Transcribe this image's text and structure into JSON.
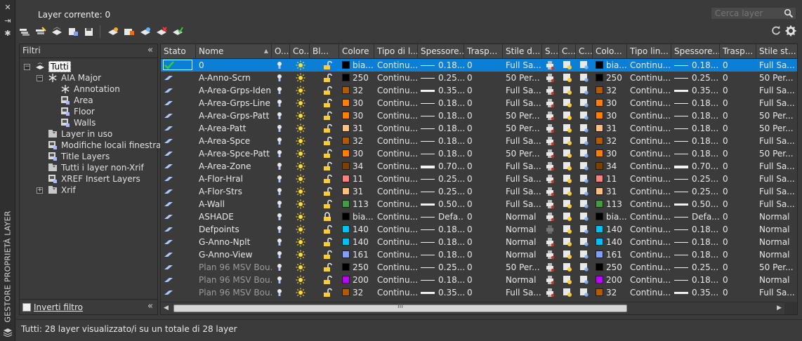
{
  "panel_title": "GESTORE PROPRIETÀ LAYER",
  "current_layer": "Layer corrente: 0",
  "search_placeholder": "Cerca layer",
  "toolbar_icons": [
    "new-property-filter-icon",
    "new-group-filter-icon",
    "layer-states-icon",
    "new-layer-icon",
    "new-layer-vp-frozen-icon",
    "delete-layer-icon",
    "set-current-icon"
  ],
  "filters": {
    "title": "Filtri",
    "tree": [
      {
        "label": "Tutti",
        "level": 0,
        "toggle": "−",
        "icon": "all-layers-icon",
        "selected": true
      },
      {
        "label": "AIA Major",
        "level": 1,
        "toggle": "−",
        "icon": "snowflake-group-icon"
      },
      {
        "label": "Annotation",
        "level": 2,
        "icon": "snowflake-group-icon"
      },
      {
        "label": "Area",
        "level": 2,
        "icon": "layer-filter-icon"
      },
      {
        "label": "Floor",
        "level": 2,
        "icon": "layer-filter-icon"
      },
      {
        "label": "Walls",
        "level": 2,
        "icon": "layer-filter-icon"
      },
      {
        "label": "Layer in uso",
        "level": 1,
        "icon": "property-filter-icon"
      },
      {
        "label": "Modifiche locali finestra",
        "level": 1,
        "icon": "layer-filter-icon"
      },
      {
        "label": "Title Layers",
        "level": 1,
        "icon": "layer-filter-icon"
      },
      {
        "label": "Tutti i layer non-Xrif",
        "level": 1,
        "icon": "property-filter-icon"
      },
      {
        "label": "XREF Insert Layers",
        "level": 1,
        "icon": "layer-filter-icon"
      },
      {
        "label": "Xrif",
        "level": 1,
        "toggle": "+",
        "icon": "property-filter-icon"
      }
    ],
    "invert_label": "Inverti filtro"
  },
  "columns": [
    "Stato",
    "Nome",
    "O...",
    "Co...",
    "Bl...",
    "Colore",
    "Tipo di l...",
    "Spessore...",
    "Trasp...",
    "Stile d...",
    "S...",
    "C...",
    "C...",
    "Colo...",
    "Tipo lin...",
    "Spessore...",
    "Trasp...",
    "Stile st..."
  ],
  "rows": [
    {
      "name": "0",
      "color": "bia...",
      "swatch": "#000000",
      "ltype": "Continu...",
      "lw": "0.18...",
      "lwh": 1,
      "tr": "0",
      "ps": "Full Sa...",
      "vcolor": "bia...",
      "vswatch": "#000000",
      "vltype": "Continu...",
      "vlw": "0.18...",
      "vlwh": 1,
      "vtr": "0",
      "vps": "Full Sa...",
      "current": true,
      "selected": true
    },
    {
      "name": "A-Anno-Scrn",
      "color": "250",
      "swatch": "#000000",
      "ltype": "Continu...",
      "lw": "0.25...",
      "lwh": 1,
      "tr": "0",
      "ps": "50 Per...",
      "vcolor": "250",
      "vswatch": "#000000",
      "vltype": "Continu...",
      "vlw": "0.25...",
      "vlwh": 1,
      "vtr": "0",
      "vps": "50 Per..."
    },
    {
      "name": "A-Area-Grps-Iden",
      "color": "32",
      "swatch": "#b35a00",
      "ltype": "Continu...",
      "lw": "0.35...",
      "lwh": 3,
      "tr": "0",
      "ps": "Full Sa...",
      "vcolor": "32",
      "vswatch": "#b35a00",
      "vltype": "Continu...",
      "vlw": "0.35...",
      "vlwh": 3,
      "vtr": "0",
      "vps": "Full Sa..."
    },
    {
      "name": "A-Area-Grps-Line",
      "color": "30",
      "swatch": "#ff7f00",
      "ltype": "Continu...",
      "lw": "0.18...",
      "lwh": 1,
      "tr": "0",
      "ps": "Full Sa...",
      "vcolor": "30",
      "vswatch": "#ff7f00",
      "vltype": "Continu...",
      "vlw": "0.18...",
      "vlwh": 1,
      "vtr": "0",
      "vps": "Full Sa..."
    },
    {
      "name": "A-Area-Grps-Patt",
      "color": "30",
      "swatch": "#ff7f00",
      "ltype": "Continu...",
      "lw": "0.18...",
      "lwh": 1,
      "tr": "0",
      "ps": "50 Per...",
      "vcolor": "30",
      "vswatch": "#ff7f00",
      "vltype": "Continu...",
      "vlw": "0.18...",
      "vlwh": 1,
      "vtr": "0",
      "vps": "50 Per..."
    },
    {
      "name": "A-Area-Patt",
      "color": "31",
      "swatch": "#ffbf7f",
      "ltype": "Continu...",
      "lw": "0.18...",
      "lwh": 1,
      "tr": "0",
      "ps": "50 Per...",
      "vcolor": "31",
      "vswatch": "#ffbf7f",
      "vltype": "Continu...",
      "vlw": "0.18...",
      "vlwh": 1,
      "vtr": "0",
      "vps": "50 Per..."
    },
    {
      "name": "A-Area-Spce",
      "color": "32",
      "swatch": "#b35a00",
      "ltype": "Continu...",
      "lw": "0.18...",
      "lwh": 1,
      "tr": "0",
      "ps": "Full Sa...",
      "vcolor": "32",
      "vswatch": "#b35a00",
      "vltype": "Continu...",
      "vlw": "0.18...",
      "vlwh": 1,
      "vtr": "0",
      "vps": "Full Sa..."
    },
    {
      "name": "A-Area-Spce-Patt",
      "color": "30",
      "swatch": "#ff7f00",
      "ltype": "Continu...",
      "lw": "0.18...",
      "lwh": 1,
      "tr": "0",
      "ps": "50 Per...",
      "vcolor": "30",
      "vswatch": "#ff7f00",
      "vltype": "Continu...",
      "vlw": "0.18...",
      "vlwh": 1,
      "vtr": "0",
      "vps": "50 Per..."
    },
    {
      "name": "A-Area-Zone",
      "color": "34",
      "swatch": "#7f3f00",
      "ltype": "Continu...",
      "lw": "0.70...",
      "lwh": 4,
      "tr": "0",
      "ps": "Full Sa...",
      "vcolor": "34",
      "vswatch": "#7f3f00",
      "vltype": "Continu...",
      "vlw": "0.70...",
      "vlwh": 4,
      "vtr": "0",
      "vps": "Full Sa..."
    },
    {
      "name": "A-Flor-Hral",
      "color": "11",
      "swatch": "#ff7f7f",
      "ltype": "Continu...",
      "lw": "0.25...",
      "lwh": 1,
      "tr": "0",
      "ps": "Full Sa...",
      "vcolor": "11",
      "vswatch": "#ff7f7f",
      "vltype": "Continu...",
      "vlw": "0.25...",
      "vlwh": 1,
      "vtr": "0",
      "vps": "Full Sa..."
    },
    {
      "name": "A-Flor-Strs",
      "color": "31",
      "swatch": "#ffbf7f",
      "ltype": "Continu...",
      "lw": "0.25...",
      "lwh": 1,
      "tr": "0",
      "ps": "Full Sa...",
      "vcolor": "31",
      "vswatch": "#ffbf7f",
      "vltype": "Continu...",
      "vlw": "0.25...",
      "vlwh": 1,
      "vtr": "0",
      "vps": "Full Sa..."
    },
    {
      "name": "A-Wall",
      "color": "113",
      "swatch": "#3f9f3f",
      "ltype": "Continu...",
      "lw": "0.50...",
      "lwh": 3,
      "tr": "0",
      "ps": "Full Sa...",
      "vcolor": "113",
      "vswatch": "#3f9f3f",
      "vltype": "Continu...",
      "vlw": "0.50...",
      "vlwh": 3,
      "vtr": "0",
      "vps": "Full Sa..."
    },
    {
      "name": "ASHADE",
      "color": "bia...",
      "swatch": "#000000",
      "ltype": "Continu...",
      "lw": "Defa...",
      "lwh": 1,
      "tr": "0",
      "ps": "Normal",
      "vcolor": "bia...",
      "vswatch": "#000000",
      "vltype": "Continu...",
      "vlw": "Defa...",
      "vlwh": 1,
      "vtr": "0",
      "vps": "Normal",
      "locked": true
    },
    {
      "name": "Defpoints",
      "color": "140",
      "swatch": "#00bfff",
      "ltype": "Continu...",
      "lw": "0.18...",
      "lwh": 1,
      "tr": "0",
      "ps": "Normal",
      "vcolor": "140",
      "vswatch": "#00bfff",
      "vltype": "Continu...",
      "vlw": "0.18...",
      "vlwh": 1,
      "vtr": "0",
      "vps": "Normal",
      "noplot": true
    },
    {
      "name": "G-Anno-Nplt",
      "color": "140",
      "swatch": "#00bfff",
      "ltype": "Continu...",
      "lw": "0.18...",
      "lwh": 1,
      "tr": "0",
      "ps": "Normal",
      "vcolor": "140",
      "vswatch": "#00bfff",
      "vltype": "Continu...",
      "vlw": "0.18...",
      "vlwh": 1,
      "vtr": "0",
      "vps": "Normal"
    },
    {
      "name": "G-Anno-View",
      "color": "161",
      "swatch": "#7f9fff",
      "ltype": "Continu...",
      "lw": "0.18...",
      "lwh": 1,
      "tr": "0",
      "ps": "Normal",
      "vcolor": "161",
      "vswatch": "#7f9fff",
      "vltype": "Continu...",
      "vlw": "0.18...",
      "vlwh": 1,
      "vtr": "0",
      "vps": "Normal"
    },
    {
      "name": "Plan 96 MSV Bou...",
      "color": "250",
      "swatch": "#000000",
      "ltype": "Continu...",
      "lw": "0.25...",
      "lwh": 1,
      "tr": "0",
      "ps": "50 Per...",
      "vcolor": "250",
      "vswatch": "#000000",
      "vltype": "Continu...",
      "vlw": "0.25...",
      "vlwh": 1,
      "vtr": "0",
      "vps": "50 Per...",
      "dim": true
    },
    {
      "name": "Plan 96 MSV Bou...",
      "color": "200",
      "swatch": "#bf00ff",
      "ltype": "Continu...",
      "lw": "0.18...",
      "lwh": 1,
      "tr": "0",
      "ps": "Normal",
      "vcolor": "200",
      "vswatch": "#bf00ff",
      "vltype": "Continu...",
      "vlw": "0.18...",
      "vlwh": 1,
      "vtr": "0",
      "vps": "Normal",
      "dim": true
    },
    {
      "name": "Plan 96 MSV Bou...",
      "color": "32",
      "swatch": "#b35a00",
      "ltype": "Continu...",
      "lw": "0.35...",
      "lwh": 3,
      "tr": "0",
      "ps": "Full Sa...",
      "vcolor": "32",
      "vswatch": "#b35a00",
      "vltype": "Continu...",
      "vlw": "0.35...",
      "vlwh": 3,
      "vtr": "0",
      "vps": "Full Sa...",
      "dim": true
    }
  ],
  "scrollbar_grip": "III",
  "status": "Tutti: 28 layer visualizzato/i su un totale di 28 layer"
}
